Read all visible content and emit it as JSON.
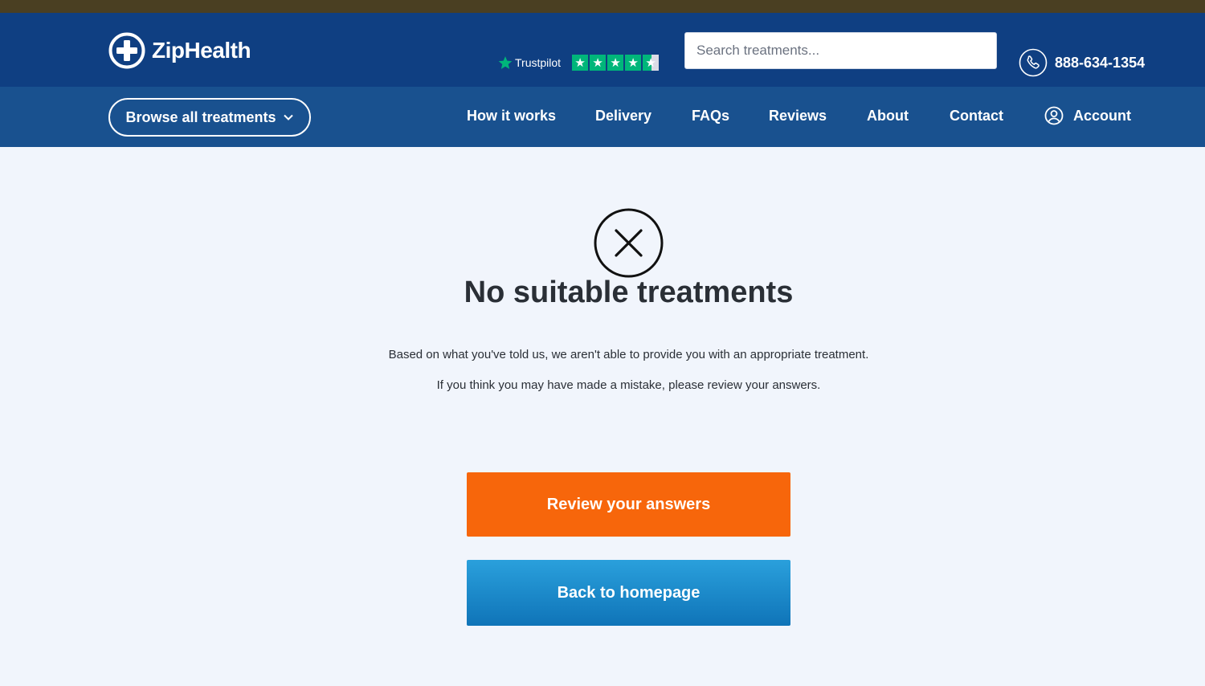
{
  "brand": {
    "name": "ZipHealth",
    "primary_color": "#0f3f82",
    "nav_color": "#19518f"
  },
  "trustpilot": {
    "label": "Trustpilot",
    "rating_stars": 4.5,
    "star_color": "#00b67a"
  },
  "search": {
    "placeholder": "Search treatments..."
  },
  "phone": {
    "number": "888-634-1354",
    "icon": "phone-icon"
  },
  "nav": {
    "browse_label": "Browse all treatments",
    "links": [
      "How it works",
      "Delivery",
      "FAQs",
      "Reviews",
      "About",
      "Contact"
    ],
    "account_label": "Account"
  },
  "result": {
    "icon": "x-circle-icon",
    "title": "No suitable treatments",
    "message_1": "Based on what you've told us, we aren't able to provide you with an appropriate treatment.",
    "message_2": "If you think you may have made a mistake, please review your answers."
  },
  "actions": {
    "review_label": "Review your answers",
    "review_color": "#f7660b",
    "home_label": "Back to homepage",
    "home_color": "#1b8bcb"
  }
}
